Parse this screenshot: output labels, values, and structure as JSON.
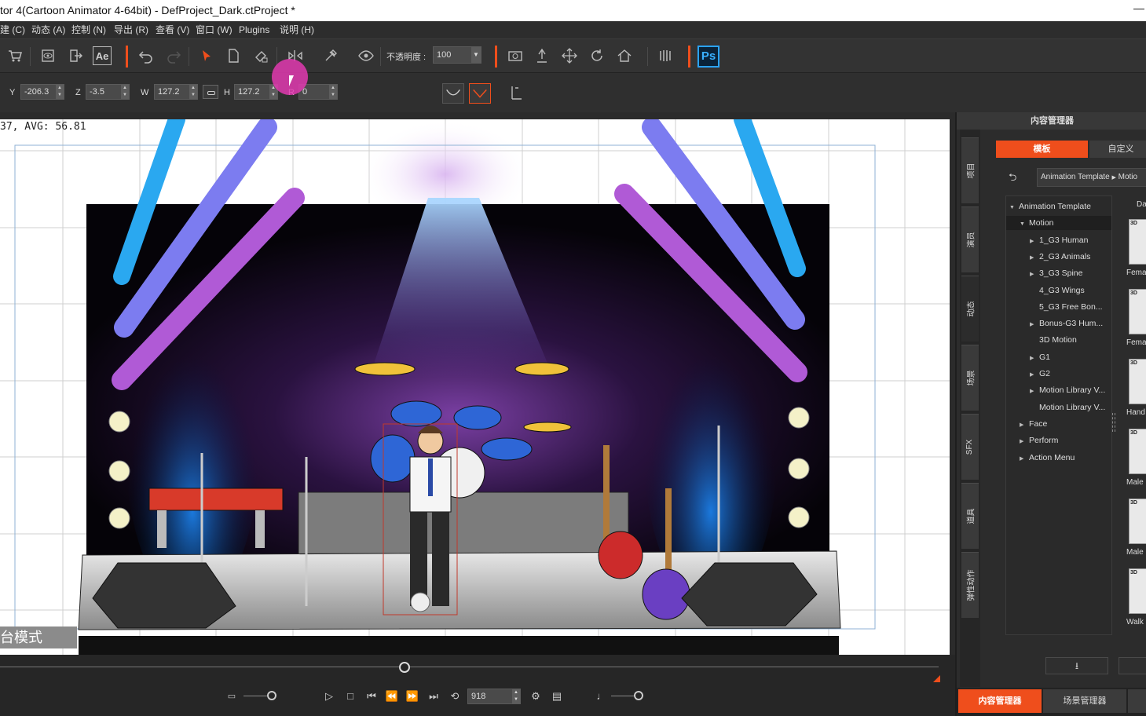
{
  "window": {
    "title": "tor 4(Cartoon Animator 4-64bit) - DefProject_Dark.ctProject *"
  },
  "menubar": {
    "items": [
      "建 (C)",
      "动态 (A)",
      "控制 (N)",
      "导出 (R)",
      "查看 (V)",
      "窗口 (W)",
      "Plugins",
      "说明 (H)"
    ]
  },
  "toolbar": {
    "ae_label": "Ae",
    "opacity_label": "不透明度 :",
    "opacity_value": "100",
    "ps_label": "Ps",
    "icons": [
      "cart-icon",
      "preview-icon",
      "export-icon",
      "ae-icon",
      "undo-icon",
      "redo-icon",
      "select-icon",
      "page-icon",
      "paint-icon",
      "flip-icon",
      "link-tool-icon",
      "eye-icon",
      "camera-icon",
      "puppet-icon",
      "move-icon",
      "rotate-icon",
      "home-icon",
      "stage-icon",
      "ps-icon"
    ],
    "accent_color": "#ef4e1c"
  },
  "transform": {
    "y_label": "Y",
    "y_value": "-206.3",
    "z_label": "Z",
    "z_value": "-3.5",
    "w_label": "W",
    "w_value": "127.2",
    "h_label": "H",
    "h_value": "127.2",
    "r_label": "R",
    "r_value": "0"
  },
  "viewport": {
    "fps_text": "37, AVG: 56.81",
    "stage_mode_label": "台模式"
  },
  "timeline": {
    "frame_value": "918"
  },
  "content_manager": {
    "header": "内容管理器",
    "tab_template": "模板",
    "tab_custom": "自定义",
    "breadcrumb_a": "Animation Template",
    "breadcrumb_b": "Motio",
    "side_tabs": [
      "项目",
      "演员",
      "动态",
      "场景",
      "SFX",
      "道具",
      "弹性动作"
    ],
    "tree": [
      {
        "label": "Animation Template",
        "arrow": "▼",
        "indent": 0
      },
      {
        "label": "Motion",
        "arrow": "▼",
        "indent": 1,
        "selected": true
      },
      {
        "label": "1_G3 Human",
        "arrow": "▶",
        "indent": 2
      },
      {
        "label": "2_G3 Animals",
        "arrow": "▶",
        "indent": 2
      },
      {
        "label": "3_G3 Spine",
        "arrow": "▶",
        "indent": 2
      },
      {
        "label": "4_G3 Wings",
        "arrow": "",
        "indent": 2
      },
      {
        "label": "5_G3 Free Bon...",
        "arrow": "",
        "indent": 2
      },
      {
        "label": "Bonus-G3 Hum...",
        "arrow": "▶",
        "indent": 2
      },
      {
        "label": "3D Motion",
        "arrow": "",
        "indent": 2
      },
      {
        "label": "G1",
        "arrow": "▶",
        "indent": 2
      },
      {
        "label": "G2",
        "arrow": "▶",
        "indent": 2
      },
      {
        "label": "Motion Library V...",
        "arrow": "▶",
        "indent": 2
      },
      {
        "label": "Motion Library V...",
        "arrow": "",
        "indent": 2
      },
      {
        "label": "Face",
        "arrow": "▶",
        "indent": 1
      },
      {
        "label": "Perform",
        "arrow": "▶",
        "indent": 1
      },
      {
        "label": "Action Menu",
        "arrow": "▶",
        "indent": 1
      }
    ],
    "thumb_header": "Da",
    "thumbs": [
      {
        "tag": "3D",
        "caption": "Fema"
      },
      {
        "tag": "3D",
        "caption": "Fema"
      },
      {
        "tag": "3D",
        "caption": "Hand"
      },
      {
        "tag": "3D",
        "caption": "Male"
      },
      {
        "tag": "3D",
        "caption": "Male"
      },
      {
        "tag": "3D",
        "caption": "Walk B"
      }
    ],
    "bottom_tab_content": "内容管理器",
    "bottom_tab_scene": "场景管理器"
  }
}
